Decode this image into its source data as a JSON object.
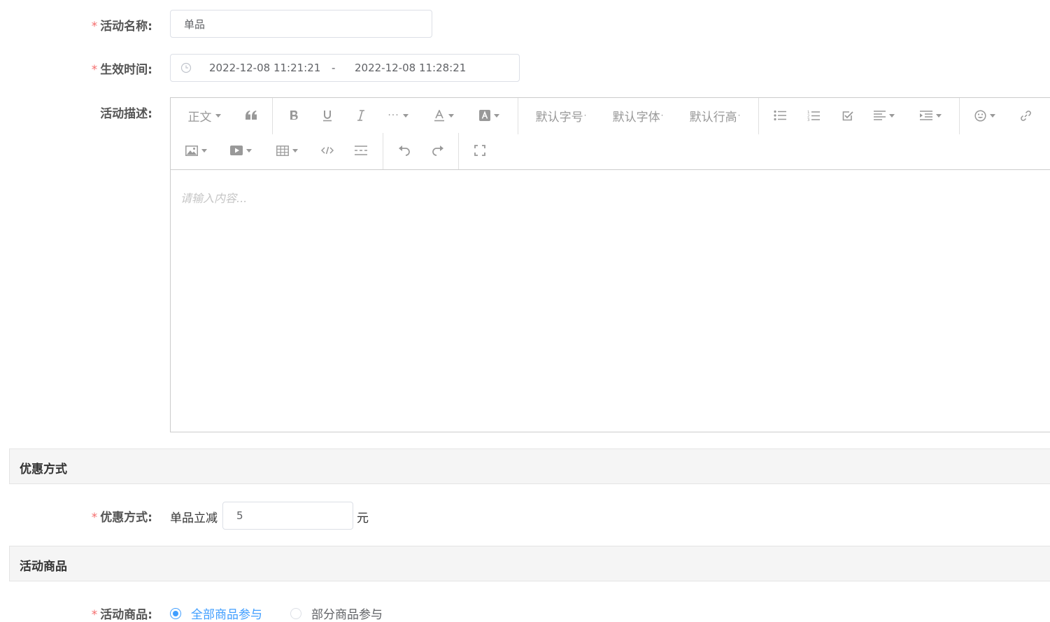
{
  "form": {
    "name": {
      "required_mark": "*",
      "label": "活动名称:",
      "value": "单品"
    },
    "time": {
      "required_mark": "*",
      "label": "生效时间:",
      "start": "2022-12-08 11:21:21",
      "separator": "-",
      "end": "2022-12-08 11:28:21"
    },
    "desc": {
      "label": "活动描述:"
    }
  },
  "editor": {
    "toolbar": {
      "paragraph": "正文",
      "font_size": "默认字号",
      "font_family": "默认字体",
      "line_height": "默认行高",
      "dot": "·",
      "icons": [
        "quote-icon",
        "bold-icon",
        "underline-icon",
        "italic-icon",
        "more-icon",
        "font-color-icon",
        "bg-color-icon",
        "bullet-list-icon",
        "numbered-list-icon",
        "todo-icon",
        "align-icon",
        "indent-icon",
        "emoji-icon",
        "link-icon",
        "image-icon",
        "video-icon",
        "table-icon",
        "code-icon",
        "divider-icon",
        "undo-icon",
        "redo-icon",
        "fullscreen-icon"
      ]
    },
    "placeholder": "请输入内容..."
  },
  "discount_section": {
    "title": "优惠方式"
  },
  "discount": {
    "required_mark": "*",
    "label": "优惠方式:",
    "prefix": "单品立减",
    "value": "5",
    "unit": "元"
  },
  "goods_section": {
    "title": "活动商品"
  },
  "goods": {
    "required_mark": "*",
    "label": "活动商品:",
    "options": [
      {
        "label": "全部商品参与",
        "selected": true
      },
      {
        "label": "部分商品参与",
        "selected": false
      }
    ],
    "accent_color": "#409eff"
  },
  "colors": {
    "required": "#f56c6c",
    "accent": "#409eff"
  }
}
